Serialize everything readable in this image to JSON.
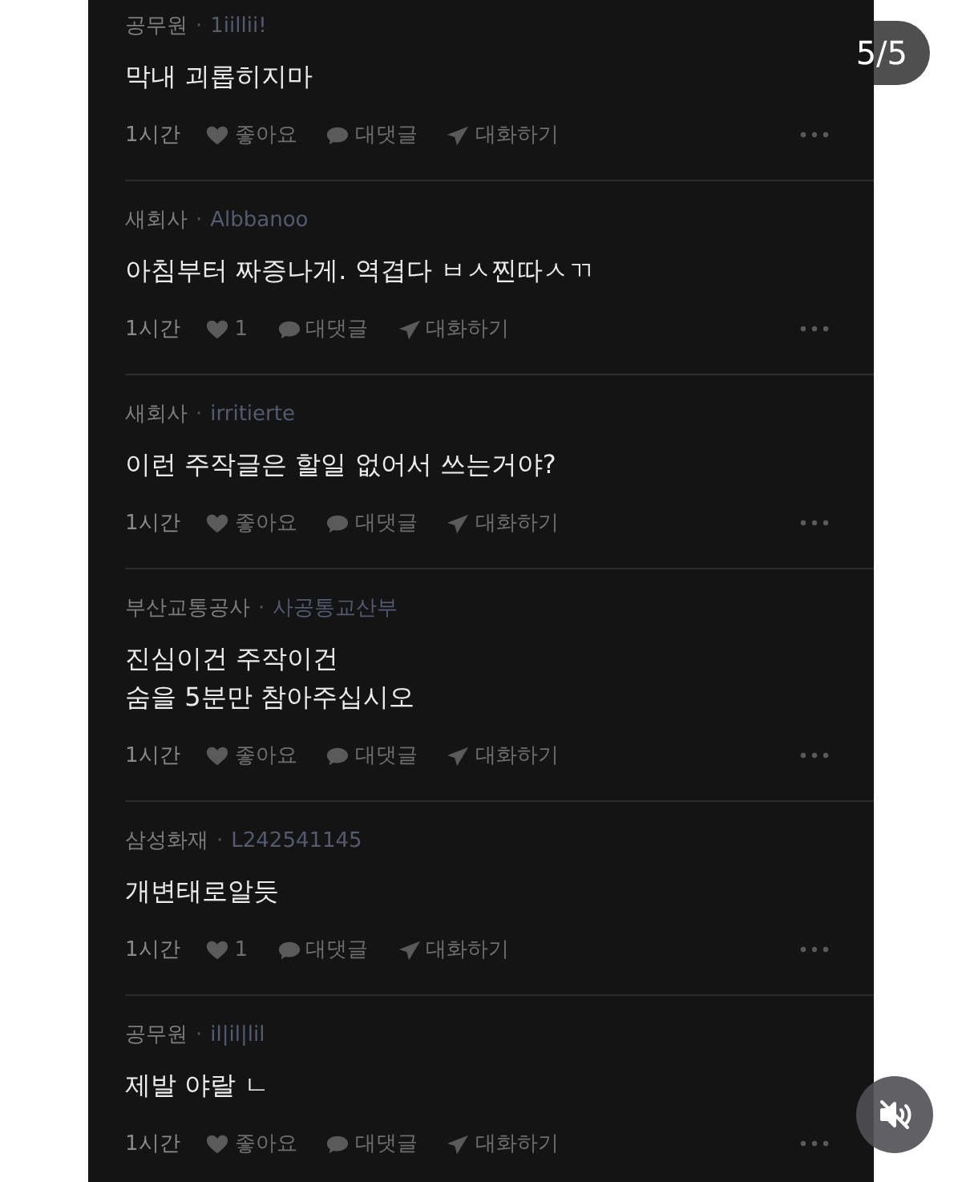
{
  "page_badge": "5/5",
  "comments": [
    {
      "company": "공무원",
      "separator": "·",
      "nickname": "1iillii!",
      "text": "막내 괴롭히지마",
      "time": "1시간",
      "like": "좋아요",
      "reply": "대댓글",
      "chat": "대화하기"
    },
    {
      "company": "새회사",
      "separator": "·",
      "nickname": "Albbanoo",
      "text": "아침부터 짜증나게. 역겹다 ㅂㅅ찐따ㅅㄲ",
      "time": "1시간",
      "like": "1",
      "reply": "대댓글",
      "chat": "대화하기"
    },
    {
      "company": "새회사",
      "separator": "·",
      "nickname": "irritierte",
      "text": "이런 주작글은 할일 없어서 쓰는거야?",
      "time": "1시간",
      "like": "좋아요",
      "reply": "대댓글",
      "chat": "대화하기"
    },
    {
      "company": "부산교통공사",
      "separator": "·",
      "nickname": "사공통교산부",
      "text": "진심이건 주작이건\n숨을 5분만 참아주십시오",
      "time": "1시간",
      "like": "좋아요",
      "reply": "대댓글",
      "chat": "대화하기"
    },
    {
      "company": "삼성화재",
      "separator": "·",
      "nickname": "L242541145",
      "text": "개변태로알듯",
      "time": "1시간",
      "like": "1",
      "reply": "대댓글",
      "chat": "대화하기"
    },
    {
      "company": "공무원",
      "separator": "·",
      "nickname": "il|il|lil",
      "text": "제발 야랄 ㄴ",
      "time": "1시간",
      "like": "좋아요",
      "reply": "대댓글",
      "chat": "대화하기"
    }
  ]
}
